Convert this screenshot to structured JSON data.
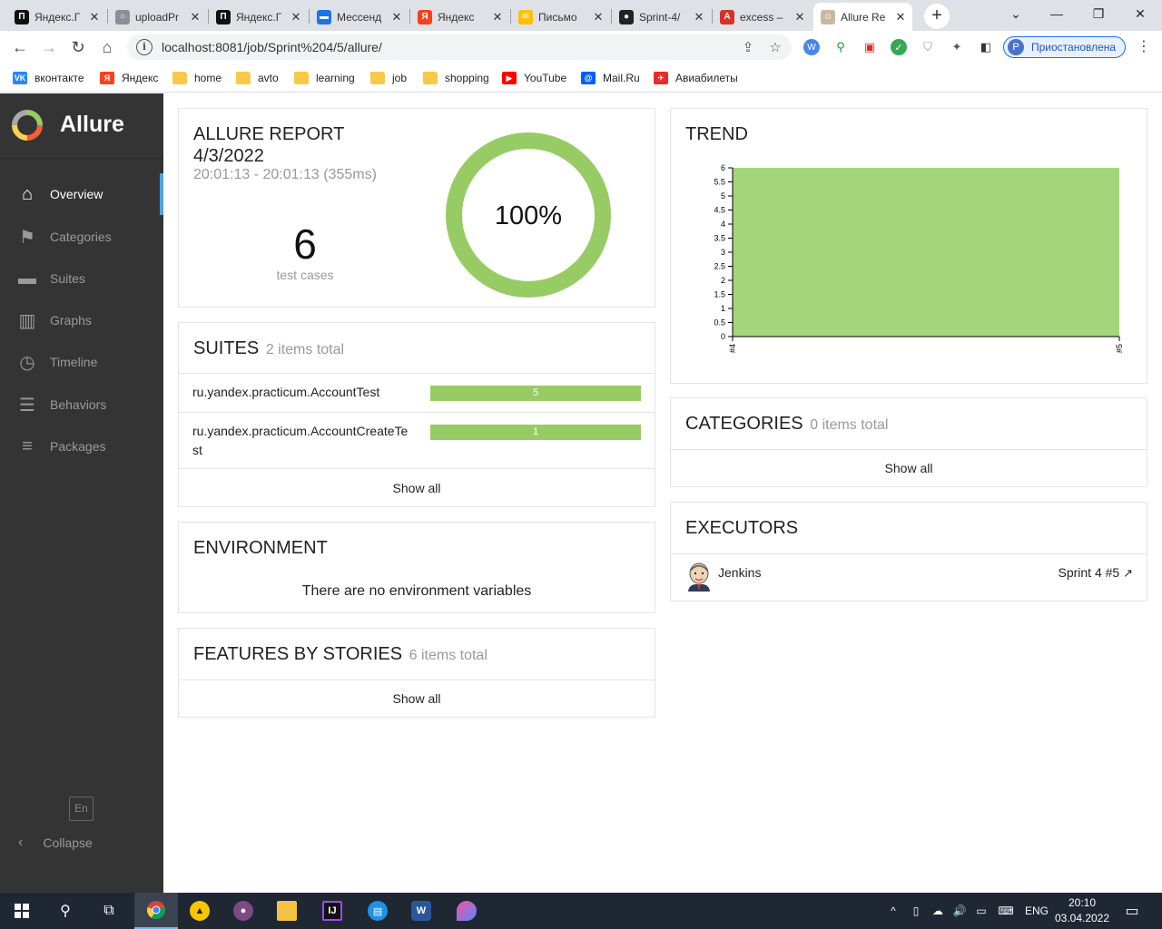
{
  "browser": {
    "tabs": [
      {
        "label": "Яндекс.Г",
        "icon": "yandex-practicum-icon",
        "color": "#111111",
        "glyph": "П"
      },
      {
        "label": "uploadPr",
        "icon": "upload-icon",
        "color": "#8a8f98",
        "glyph": "○"
      },
      {
        "label": "Яндекс.Г",
        "icon": "yandex-practicum-icon",
        "color": "#111111",
        "glyph": "П"
      },
      {
        "label": "Мессенд",
        "icon": "messenger-icon",
        "color": "#1a73e8",
        "glyph": "▬"
      },
      {
        "label": "Яндекс",
        "icon": "yandex-icon",
        "color": "#fc3f1d",
        "glyph": "Я"
      },
      {
        "label": "Письмо",
        "icon": "mail-envelope-icon",
        "color": "#ffbf00",
        "glyph": "✉"
      },
      {
        "label": "Sprint-4/",
        "icon": "github-icon",
        "color": "#222222",
        "glyph": "●"
      },
      {
        "label": "excess –",
        "icon": "excess-icon",
        "color": "#d93025",
        "glyph": "A"
      },
      {
        "label": "Allure Re",
        "icon": "jenkins-icon",
        "color": "#c9b8a0",
        "glyph": "☺"
      }
    ],
    "new_tab": "+",
    "url": "localhost:8081/job/Sprint%204/5/allure/",
    "profile_initial": "P",
    "profile_label": "Приостановлена",
    "bookmarks": [
      {
        "label": "вконтакте",
        "icon": "vk-icon",
        "color": "#2787f5",
        "glyph": "VK"
      },
      {
        "label": "Яндекс",
        "icon": "yandex-icon",
        "color": "#fc3f1d",
        "glyph": "Я"
      },
      {
        "label": "home",
        "icon": "folder-icon",
        "color": "#f7c948",
        "glyph": ""
      },
      {
        "label": "avto",
        "icon": "folder-icon",
        "color": "#f7c948",
        "glyph": ""
      },
      {
        "label": "learning",
        "icon": "folder-icon",
        "color": "#f7c948",
        "glyph": ""
      },
      {
        "label": "job",
        "icon": "folder-icon",
        "color": "#f7c948",
        "glyph": ""
      },
      {
        "label": "shopping",
        "icon": "folder-icon",
        "color": "#f7c948",
        "glyph": ""
      },
      {
        "label": "YouTube",
        "icon": "youtube-icon",
        "color": "#ff0000",
        "glyph": "▶"
      },
      {
        "label": "Mail.Ru",
        "icon": "mailru-icon",
        "color": "#005ff9",
        "glyph": "@"
      },
      {
        "label": "Авиабилеты",
        "icon": "tickets-icon",
        "color": "#e52b2b",
        "glyph": "✈"
      }
    ]
  },
  "sidebar": {
    "brand": "Allure",
    "items": [
      {
        "label": "Overview",
        "icon": "home-icon",
        "active": true
      },
      {
        "label": "Categories",
        "icon": "flag-icon",
        "active": false
      },
      {
        "label": "Suites",
        "icon": "briefcase-icon",
        "active": false
      },
      {
        "label": "Graphs",
        "icon": "bar-chart-icon",
        "active": false
      },
      {
        "label": "Timeline",
        "icon": "clock-icon",
        "active": false
      },
      {
        "label": "Behaviors",
        "icon": "list-icon",
        "active": false
      },
      {
        "label": "Packages",
        "icon": "align-left-icon",
        "active": false
      }
    ],
    "language": "En",
    "collapse_label": "Collapse"
  },
  "summary": {
    "title_line1": "ALLURE REPORT",
    "title_line2": "4/3/2022",
    "time_range": "20:01:13 - 20:01:13 (355ms)",
    "test_count": "6",
    "test_unit": "test cases",
    "pass_percent_label": "100%",
    "pass_fraction": 1.0,
    "pass_color": "#97cc64"
  },
  "suites": {
    "title": "SUITES",
    "subtitle": "2 items total",
    "rows": [
      {
        "name": "ru.yandex.practicum.AccountTest",
        "count": "5"
      },
      {
        "name": "ru.yandex.practicum.AccountCreateTest",
        "count": "1"
      }
    ],
    "show_all": "Show all"
  },
  "environment": {
    "title": "ENVIRONMENT",
    "empty_text": "There are no environment variables"
  },
  "features": {
    "title": "FEATURES BY STORIES",
    "subtitle": "6 items total",
    "show_all": "Show all"
  },
  "trend": {
    "title": "TREND"
  },
  "chart_data": {
    "type": "area",
    "title": "TREND",
    "x": [
      "#4",
      "#5"
    ],
    "series": [
      {
        "values": [
          6,
          6
        ],
        "color": "#a5d57a"
      }
    ],
    "yticks": [
      "0",
      "0.5",
      "1",
      "1.5",
      "2",
      "2.5",
      "3",
      "3.5",
      "4",
      "4.5",
      "5",
      "5.5",
      "6"
    ],
    "ylim": [
      0,
      6
    ],
    "grid": false
  },
  "categories": {
    "title": "CATEGORIES",
    "subtitle": "0 items total",
    "show_all": "Show all"
  },
  "executors": {
    "title": "EXECUTORS",
    "name": "Jenkins",
    "build": "Sprint 4 #5"
  },
  "taskbar": {
    "language": "ENG",
    "time": "20:10",
    "date": "03.04.2022"
  }
}
